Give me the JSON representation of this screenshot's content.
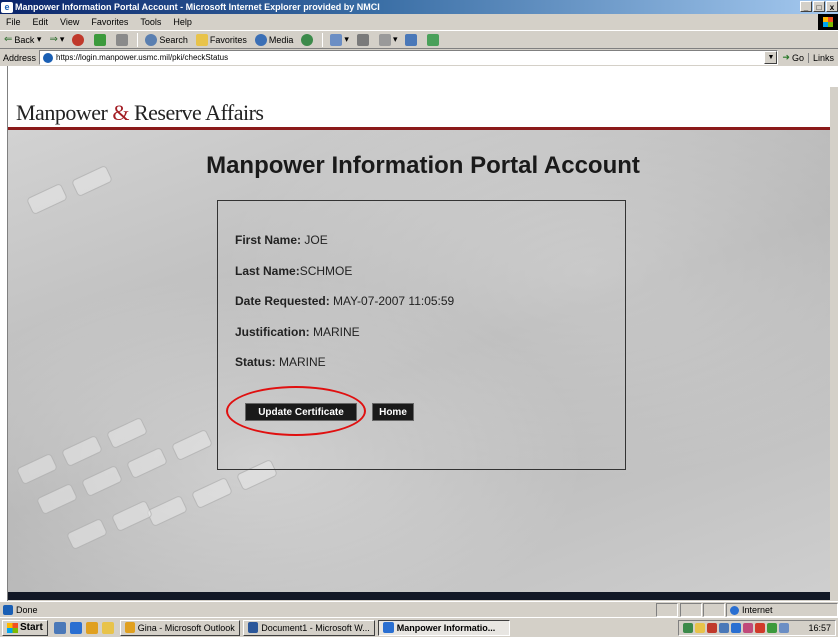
{
  "window": {
    "title": "Manpower Information Portal Account - Microsoft Internet Explorer provided by NMCI",
    "min": "_",
    "max": "□",
    "close": "x"
  },
  "menu": [
    "File",
    "Edit",
    "View",
    "Favorites",
    "Tools",
    "Help"
  ],
  "toolbar": {
    "back": "Back",
    "search": "Search",
    "favorites": "Favorites",
    "media": "Media"
  },
  "address": {
    "label": "Address",
    "url": "https://login.manpower.usmc.mil/pki/checkStatus",
    "go": "Go",
    "links": "Links"
  },
  "page": {
    "brand_left": "Manpower",
    "brand_amp": "&",
    "brand_right": "Reserve Affairs",
    "title": "Manpower Information Portal Account",
    "fields": {
      "first_name_label": "First Name:",
      "first_name_value": "JOE",
      "last_name_label": "Last Name:",
      "last_name_value": "SCHMOE",
      "date_label": "Date Requested:",
      "date_value": "MAY-07-2007 11:05:59",
      "justification_label": "Justification:",
      "justification_value": "MARINE",
      "status_label": "Status:",
      "status_value": "MARINE"
    },
    "update_button": "Update Certificate",
    "home_button": "Home"
  },
  "status": {
    "text": "Done",
    "zone": "Internet"
  },
  "taskbar": {
    "start": "Start",
    "tasks": [
      "Gina - Microsoft Outlook",
      "Document1 - Microsoft W...",
      "Manpower Informatio..."
    ],
    "clock": "16:57"
  },
  "colors": {
    "brand_red": "#a31d24",
    "highlight_circle": "#e01010",
    "button_bg": "#1a1a1a"
  }
}
